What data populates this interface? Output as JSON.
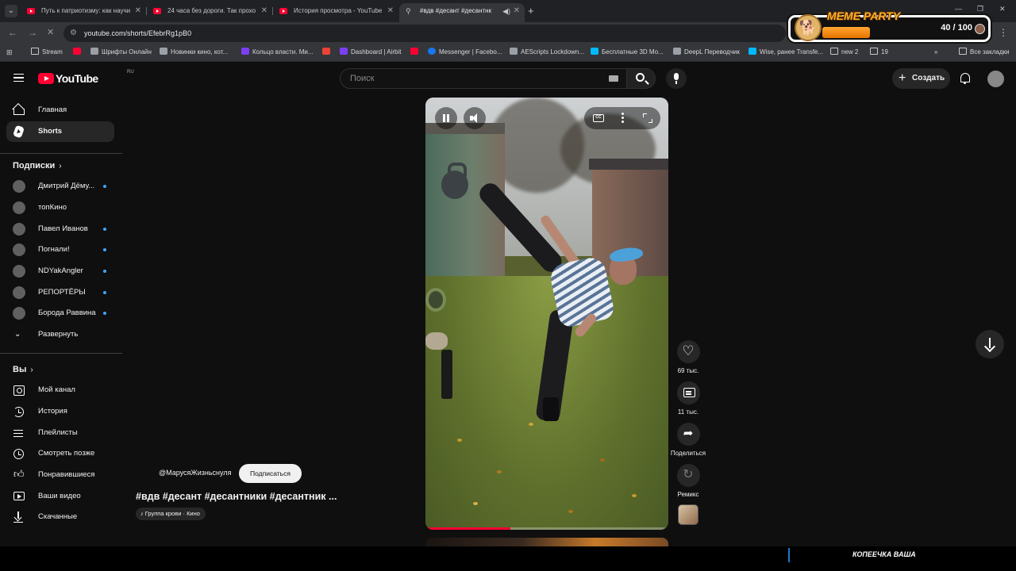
{
  "browser": {
    "tabs": [
      {
        "title": "Путь к патриотизму: как научить",
        "active": false,
        "icon": "youtube-icon"
      },
      {
        "title": "24 часа без дороги. Так прохо",
        "active": false,
        "icon": "youtube-icon"
      },
      {
        "title": "История просмотра - YouTube",
        "active": false,
        "icon": "youtube-icon"
      },
      {
        "title": "#вдв #десант #десантнк",
        "active": true,
        "icon": "link-icon"
      }
    ],
    "new_tab_label": "+",
    "url": "youtube.com/shorts/EfebrRg1pB0",
    "bookmarks": [
      {
        "label": "Stream",
        "icon": "folder-icon"
      },
      {
        "label": "",
        "icon": "red-icon"
      },
      {
        "label": "Шрифты Онлайн",
        "icon": "gray-icon"
      },
      {
        "label": "Новинки кино, кот...",
        "icon": "gray-icon"
      },
      {
        "label": "Кольцо власти. Ми...",
        "icon": "purple-icon"
      },
      {
        "label": "",
        "icon": "gmail-icon"
      },
      {
        "label": "Dashboard | Airbit",
        "icon": "purple-icon"
      },
      {
        "label": "",
        "icon": "red-icon"
      },
      {
        "label": "Messenger | Facebo...",
        "icon": "blue-icon"
      },
      {
        "label": "AEScripts Lockdown...",
        "icon": "gray-icon"
      },
      {
        "label": "Бесплатные 3D Mo...",
        "icon": "teal-icon"
      },
      {
        "label": "DeepL Переводчик",
        "icon": "gray-icon"
      },
      {
        "label": "Wise, ранее Transfe...",
        "icon": "teal-icon"
      },
      {
        "label": "new 2",
        "icon": "folder-icon"
      },
      {
        "label": "19",
        "icon": "folder-icon"
      }
    ],
    "bookmarks_more": "»",
    "all_bookmarks": "Все закладки"
  },
  "meme_overlay": {
    "title": "MEME PARTY",
    "count": "40 / 100",
    "progress": 0.4
  },
  "youtube": {
    "logo": "YouTube",
    "region": "RU",
    "search_placeholder": "Поиск",
    "create_label": "Создать"
  },
  "sidebar": {
    "main": [
      {
        "label": "Главная",
        "icon": "home-icon",
        "active": false
      },
      {
        "label": "Shorts",
        "icon": "shorts-icon",
        "active": true
      }
    ],
    "subscriptions_title": "Подписки",
    "subscriptions": [
      {
        "label": "Дмитрий Дёму...",
        "new": true
      },
      {
        "label": "топКино",
        "new": false
      },
      {
        "label": "Павел Иванов",
        "new": true
      },
      {
        "label": "Погнали!",
        "new": true
      },
      {
        "label": "NDYakAngler",
        "new": true
      },
      {
        "label": "РЕПОРТЁРЫ",
        "new": true
      },
      {
        "label": "Борода Раввина",
        "new": true
      }
    ],
    "expand_label": "Развернуть",
    "you_title": "Вы",
    "you_items": [
      {
        "label": "Мой канал",
        "icon": "user-icon"
      },
      {
        "label": "История",
        "icon": "history-icon"
      },
      {
        "label": "Плейлисты",
        "icon": "playlist-icon"
      },
      {
        "label": "Смотреть позже",
        "icon": "clock-icon"
      },
      {
        "label": "Понравившиеся",
        "icon": "like-icon"
      },
      {
        "label": "Ваши видео",
        "icon": "video-icon"
      },
      {
        "label": "Скачанные",
        "icon": "download-icon"
      }
    ]
  },
  "short": {
    "channel": "@МарусяЖизньснуля",
    "subscribe_label": "Подписаться",
    "title": "#вдв #десант #десантники #десантник ...",
    "music": "Группа крови · Кино",
    "progress": 0.35,
    "likes": "69 тыс.",
    "comments": "11 тыс.",
    "share_label": "Поделиться",
    "remix_label": "Ремикс"
  },
  "stream_overlay": {
    "text": "КОПЕЕЧКА ВАША"
  },
  "colors": {
    "background": "#0f0f0f",
    "accent": "#ff0033",
    "notify_dot": "#3ea6ff"
  }
}
